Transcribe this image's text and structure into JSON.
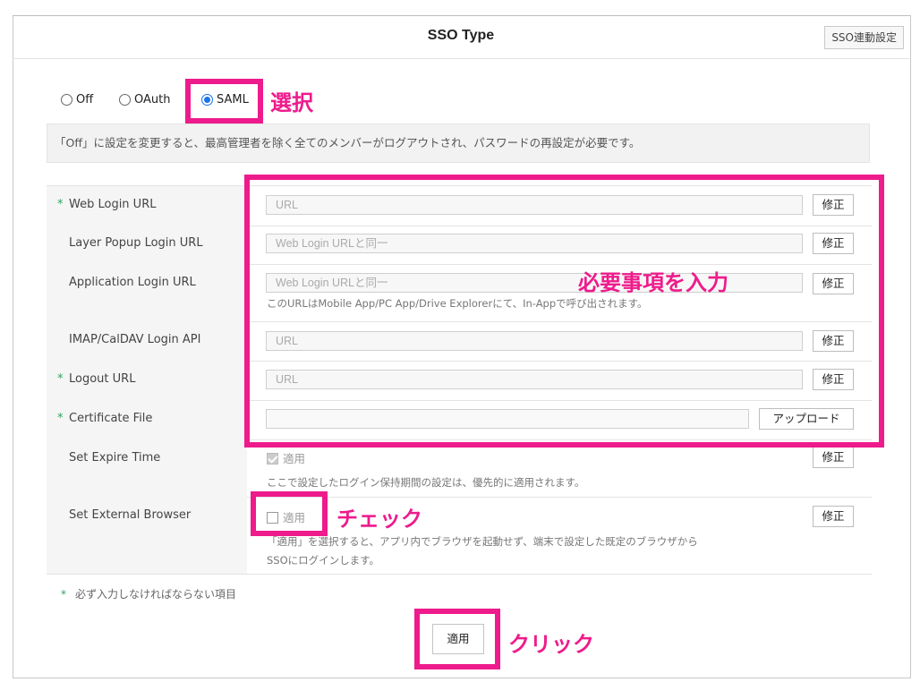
{
  "header": {
    "title": "SSO Type",
    "settings_button": "SSO連動設定"
  },
  "sso_type": {
    "options": [
      {
        "label": "Off",
        "selected": false
      },
      {
        "label": "OAuth",
        "selected": false
      },
      {
        "label": "SAML",
        "selected": true
      }
    ]
  },
  "notice": "「Off」に設定を変更すると、最高管理者を除く全てのメンバーがログアウトされ、パスワードの再設定が必要です。",
  "fields": {
    "web_login": {
      "required": "*",
      "label": "Web Login URL",
      "placeholder": "URL",
      "button": "修正"
    },
    "layer_popup": {
      "label": "Layer Popup Login URL",
      "placeholder": "Web Login URLと同一",
      "button": "修正"
    },
    "application_login": {
      "label": "Application Login URL",
      "placeholder": "Web Login URLと同一",
      "button": "修正",
      "help": "このURLはMobile App/PC App/Drive Explorerにて、In-Appで呼び出されます。"
    },
    "imap": {
      "label": "IMAP/CalDAV Login API",
      "placeholder": "URL",
      "button": "修正"
    },
    "logout": {
      "required": "*",
      "label": "Logout URL",
      "placeholder": "URL",
      "button": "修正"
    },
    "certificate": {
      "required": "*",
      "label": "Certificate File",
      "value": "",
      "button": "アップロード"
    },
    "expire_time": {
      "label": "Set Expire Time",
      "checkbox_label": "適用",
      "checked": true,
      "button": "修正",
      "help": "ここで設定したログイン保持期間の設定は、優先的に適用されます。"
    },
    "external_browser": {
      "label": "Set External Browser",
      "checkbox_label": "適用",
      "checked": false,
      "button": "修正",
      "help_line1": "「適用」を選択すると、アプリ内でブラウザを起動せず、端末で設定した既定のブラウザから",
      "help_line2": "SSOにログインします。"
    }
  },
  "required_note": {
    "star": "*",
    "text": "必ず入力しなければならない項目"
  },
  "apply_button": "適用",
  "annotations": {
    "select": "選択",
    "enter_required": "必要事項を入力",
    "check": "チェック",
    "click": "クリック",
    "highlight_color": "#ee1b8c"
  },
  "colors": {
    "accent": "#1a73e8",
    "required": "#2aa55a"
  }
}
